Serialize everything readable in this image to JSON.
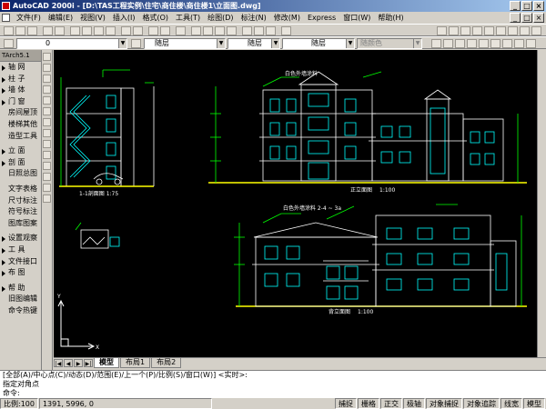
{
  "title_bar": {
    "title": "AutoCAD 2000i - [D:\\TAS工程实例\\住宅\\商住楼\\商住楼1\\立面图.dwg]",
    "min": "_",
    "max": "□",
    "close": "×"
  },
  "menu": [
    "文件(F)",
    "编辑(E)",
    "视图(V)",
    "插入(I)",
    "格式(O)",
    "工具(T)",
    "绘图(D)",
    "标注(N)",
    "修改(M)",
    "Express",
    "窗口(W)",
    "帮助(H)"
  ],
  "toolbar": {
    "layer_value": "0",
    "layer_combo_1": "随层",
    "linetype_combo": "随层",
    "lineweight_combo": "随层",
    "plotstyle_combo": "随颜色"
  },
  "sidebar": {
    "header": "TArch5.1",
    "items": [
      "轴 网",
      "柱 子",
      "墙 体",
      "门 窗",
      "房间屋顶",
      "楼梯其他",
      "造型工具",
      "立 面",
      "剖 面",
      "日照总图",
      "文字表格",
      "尺寸标注",
      "符号标注",
      "图库图案",
      "设置观察",
      "工 具",
      "文件接口",
      "布 图",
      "帮 助",
      "旧图编辑",
      "命令热键"
    ]
  },
  "drawing": {
    "section_title": "1-1剖面图 1:75",
    "front_elev_title": "正立面图",
    "front_scale": "1:100",
    "back_elev_title": "背立面图",
    "back_scale": "1:100",
    "note_front": "白色外墙涂料",
    "note_back": "白色外墙涂料 2-4 ~ 3a",
    "ucs_x": "X",
    "ucs_y": "Y"
  },
  "tabs": [
    "模型",
    "布局1",
    "布局2"
  ],
  "command": {
    "line1": "[全部(A)/中心点(C)/动态(D)/范围(E)/上一个(P)/比例(S)/窗口(W)] <实时>:",
    "line2": "指定对角点",
    "line3": "命令:"
  },
  "status": {
    "scale": "比例:100",
    "coords": "1391, 5996, 0",
    "toggles": [
      "捕捉",
      "栅格",
      "正交",
      "极轴",
      "对象捕捉",
      "对象追踪",
      "线宽",
      "模型"
    ]
  }
}
